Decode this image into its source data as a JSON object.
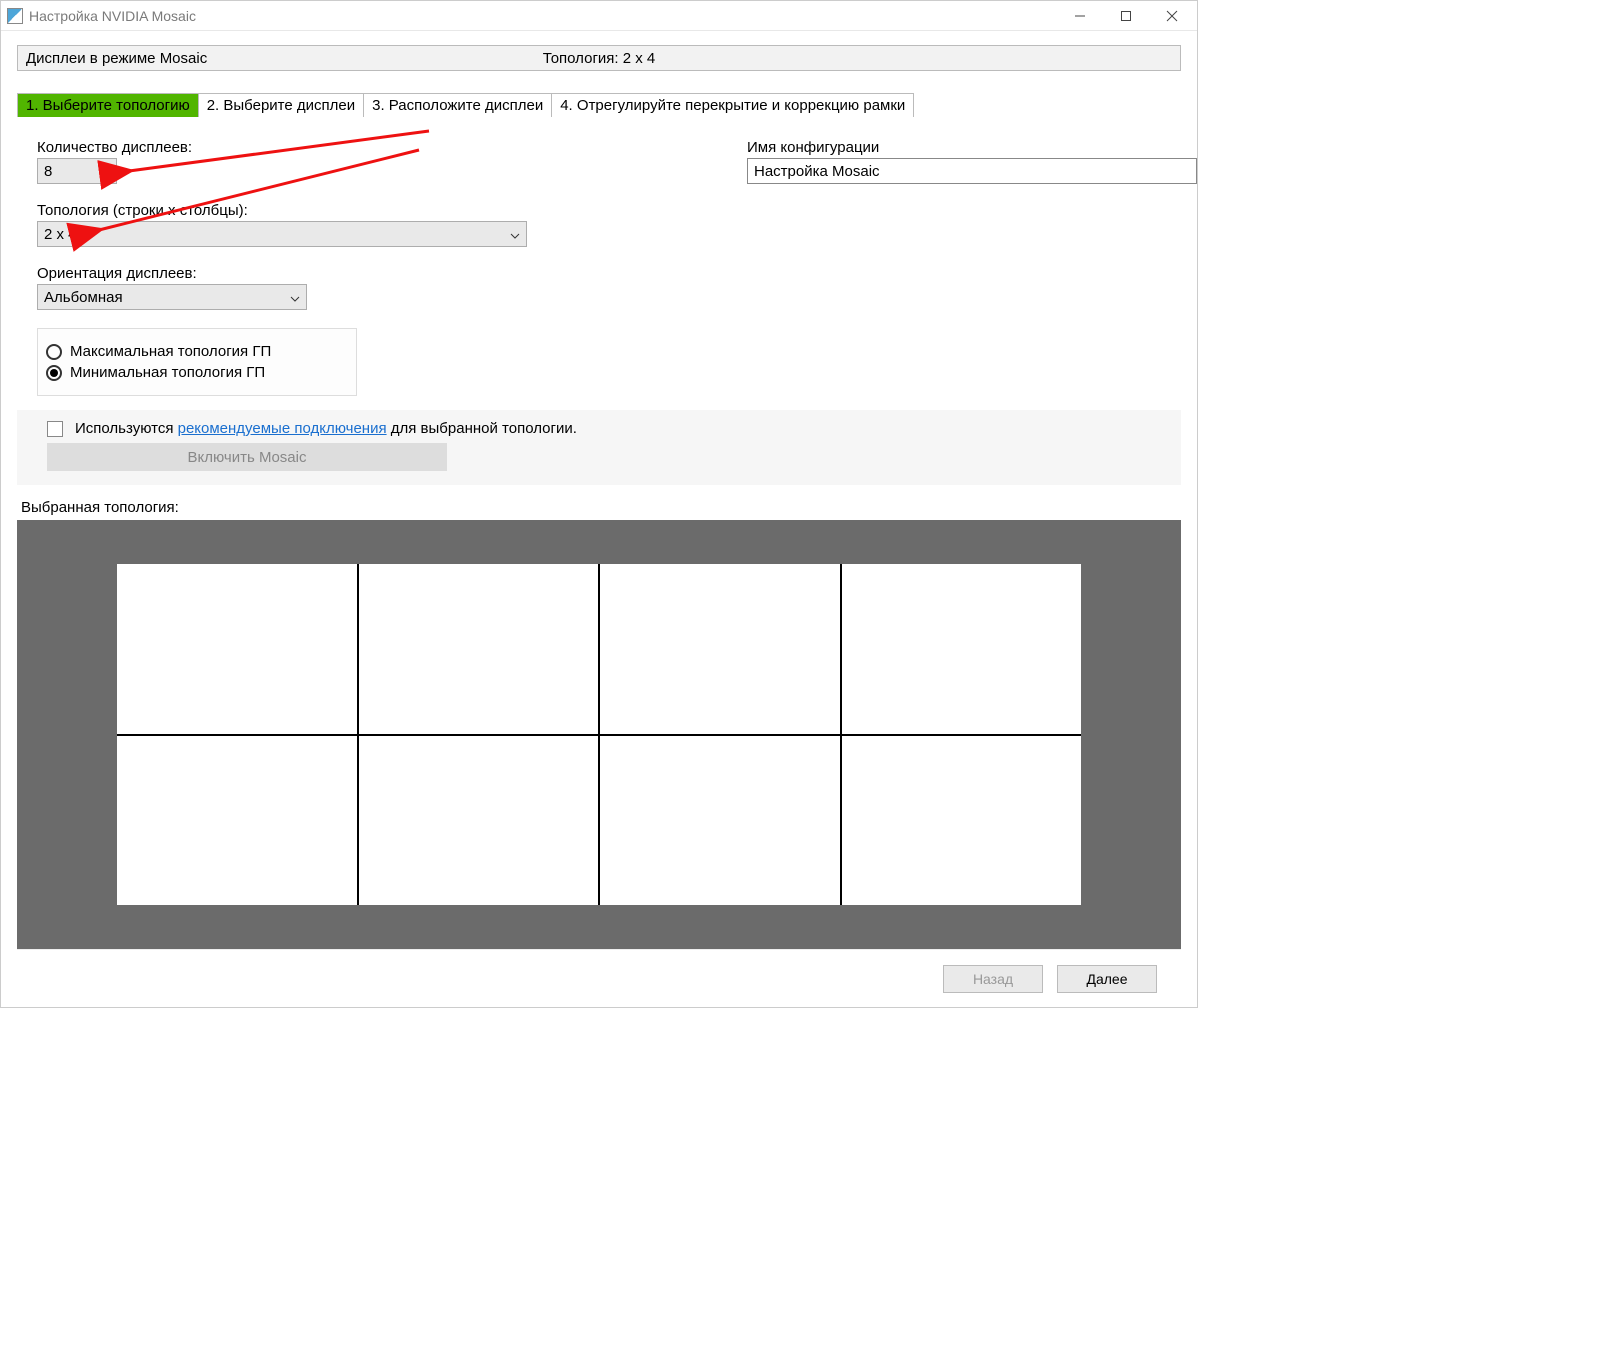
{
  "window": {
    "title": "Настройка NVIDIA Mosaic"
  },
  "header": {
    "left": "Дисплеи в режиме Mosaic",
    "right": "Топология: 2 x 4"
  },
  "tabs": [
    "1. Выберите топологию",
    "2. Выберите дисплеи",
    "3. Расположите дисплеи",
    "4. Отрегулируйте перекрытие и коррекцию рамки"
  ],
  "form": {
    "displayCount": {
      "label": "Количество дисплеев:",
      "value": "8"
    },
    "topology": {
      "label": "Топология (строки x столбцы):",
      "value": "2 x 4"
    },
    "orientation": {
      "label": "Ориентация дисплеев:",
      "value": "Альбомная"
    },
    "configName": {
      "label": "Имя конфигурации",
      "value": "Настройка Mosaic"
    },
    "radios": {
      "max": "Максимальная топология ГП",
      "min": "Минимальная топология ГП"
    },
    "recommended": {
      "prefix": "Используются",
      "link": "рекомендуемые подключения",
      "suffix": "для выбранной топологии."
    },
    "enableBtn": "Включить Mosaic",
    "selectedLabel": "Выбранная топология:"
  },
  "footer": {
    "back": "Назад",
    "next": "Далее"
  },
  "grid": {
    "rows": 2,
    "cols": 4
  }
}
